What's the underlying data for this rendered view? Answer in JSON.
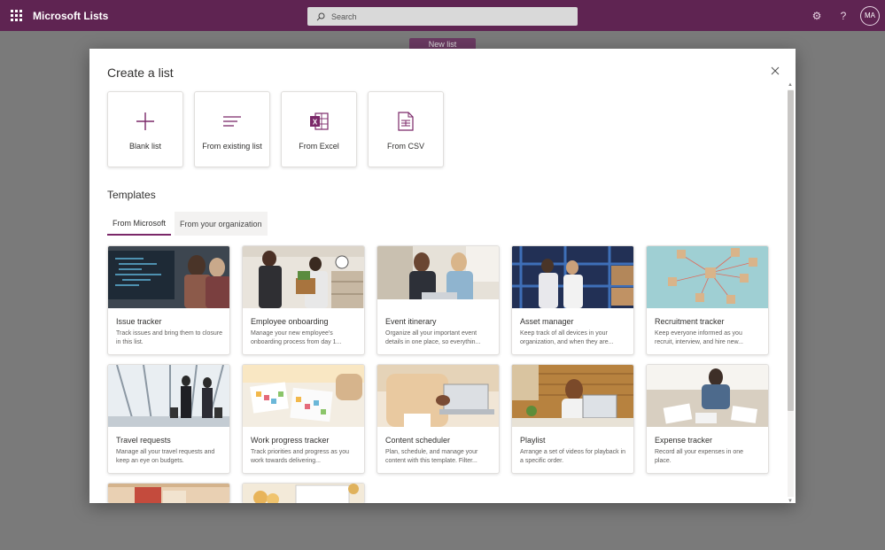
{
  "app": {
    "title": "Microsoft Lists"
  },
  "search": {
    "placeholder": "Search"
  },
  "topbar": {
    "avatar_initials": "MA",
    "icons": [
      "waffle-icon",
      "search-icon",
      "gear-icon",
      "help-icon"
    ]
  },
  "background": {
    "new_list_label": "New list"
  },
  "dialog": {
    "title": "Create a list",
    "create_options": [
      {
        "label": "Blank list",
        "icon": "plus-icon"
      },
      {
        "label": "From existing list",
        "icon": "lines-icon"
      },
      {
        "label": "From Excel",
        "icon": "excel-icon"
      },
      {
        "label": "From CSV",
        "icon": "csv-icon"
      }
    ],
    "templates_title": "Templates",
    "tabs": [
      {
        "label": "From Microsoft",
        "active": true
      },
      {
        "label": "From your organization",
        "active": false
      }
    ],
    "templates": [
      {
        "name": "Issue tracker",
        "desc": "Track issues and bring them to closure in this list."
      },
      {
        "name": "Employee onboarding",
        "desc": "Manage your new employee's onboarding process from day 1..."
      },
      {
        "name": "Event itinerary",
        "desc": "Organize all your important event details in one place, so everythin..."
      },
      {
        "name": "Asset manager",
        "desc": "Keep track of all devices in your organization, and when they are..."
      },
      {
        "name": "Recruitment tracker",
        "desc": "Keep everyone informed as you recruit, interview, and hire new..."
      },
      {
        "name": "Travel requests",
        "desc": "Manage all your travel requests and keep an eye on budgets."
      },
      {
        "name": "Work progress tracker",
        "desc": "Track priorities and progress as you work towards delivering..."
      },
      {
        "name": "Content scheduler",
        "desc": "Plan, schedule, and manage your content with this template. Filter..."
      },
      {
        "name": "Playlist",
        "desc": "Arrange a set of videos for playback in a specific order."
      },
      {
        "name": "Expense tracker",
        "desc": "Record all your expenses in one place."
      }
    ]
  },
  "colors": {
    "suite_bar": "#5f2452",
    "accent": "#7b2869",
    "excel_green": "#7b2869"
  }
}
